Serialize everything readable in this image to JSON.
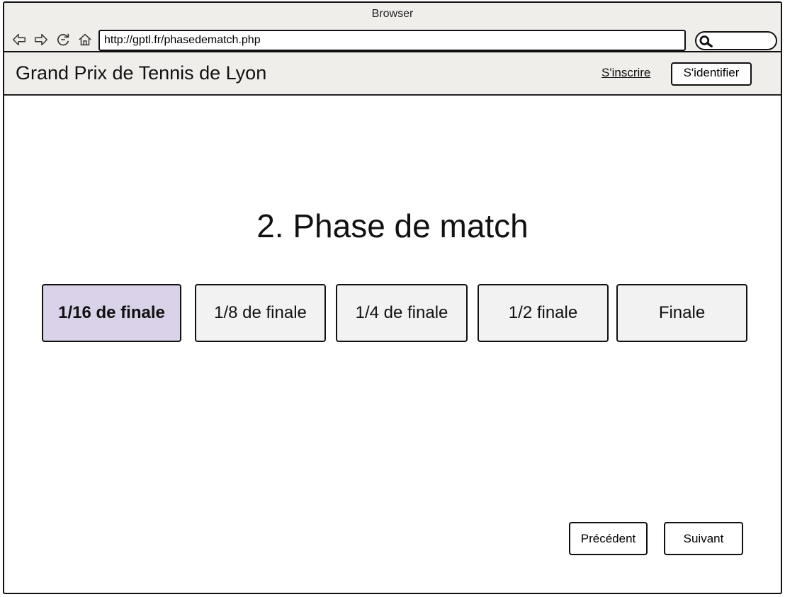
{
  "browser": {
    "title": "Browser",
    "url": "http://gptl.fr/phasedematch.php",
    "nav_icons": [
      "back-icon",
      "forward-icon",
      "reload-icon",
      "home-icon"
    ],
    "search_icon": "search-icon"
  },
  "header": {
    "site_title": "Grand Prix de Tennis de Lyon",
    "signup_label": "S'inscrire",
    "login_label": "S'identifier"
  },
  "main": {
    "page_title": "2. Phase de match",
    "phases": [
      {
        "label": "1/16 de finale",
        "selected": true
      },
      {
        "label": "1/8 de finale",
        "selected": false
      },
      {
        "label": "1/4 de finale",
        "selected": false
      },
      {
        "label": "1/2 finale",
        "selected": false
      },
      {
        "label": "Finale",
        "selected": false
      }
    ],
    "selected_color": "#d9d2e8",
    "unselected_color": "#f2f2f2"
  },
  "footer": {
    "previous_label": "Précédent",
    "next_label": "Suivant"
  }
}
